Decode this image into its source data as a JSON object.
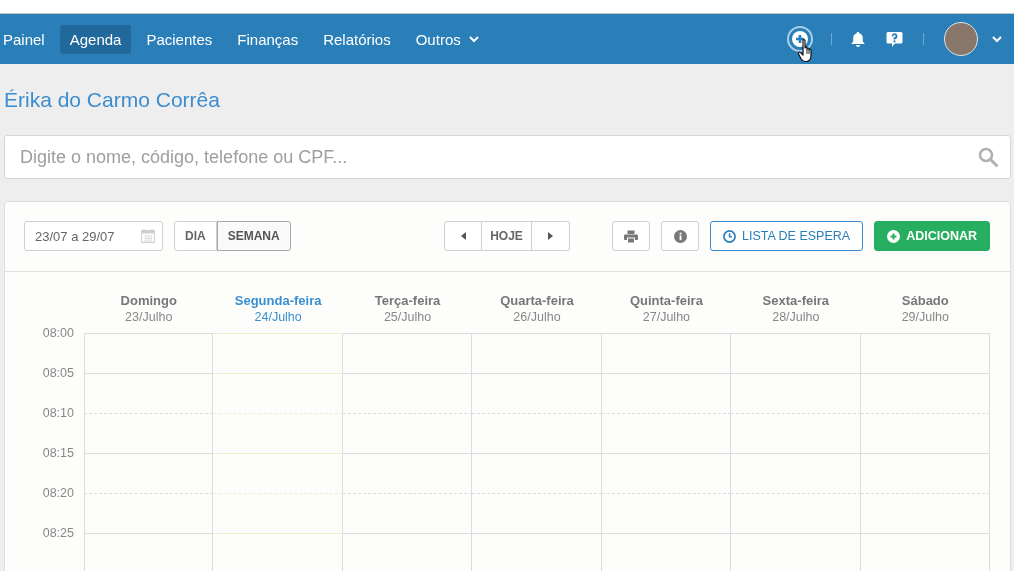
{
  "top_nav": {
    "items": [
      {
        "label": "Painel",
        "selected": false,
        "kind": "link"
      },
      {
        "label": "Agenda",
        "selected": true,
        "kind": "link"
      },
      {
        "label": "Pacientes",
        "selected": false,
        "kind": "link"
      },
      {
        "label": "Finanças",
        "selected": false,
        "kind": "link"
      },
      {
        "label": "Relatórios",
        "selected": false,
        "kind": "link"
      },
      {
        "label": "Outros",
        "selected": false,
        "kind": "dropdown"
      }
    ]
  },
  "patient_name": "Érika do Carmo Corrêa",
  "search": {
    "placeholder": "Digite o nome, código, telefone ou CPF..."
  },
  "toolbar": {
    "date_range": "23/07 a 29/07",
    "view_modes": [
      {
        "label": "DIA",
        "selected": false
      },
      {
        "label": "SEMANA",
        "selected": true
      }
    ],
    "today_button": "HOJE",
    "waitlist_button": "LISTA DE ESPERA",
    "add_button": "ADICIONAR"
  },
  "calendar": {
    "days": [
      {
        "name": "Domingo",
        "date": "23/Julho",
        "selected": false
      },
      {
        "name": "Segunda-feira",
        "date": "24/Julho",
        "selected": true
      },
      {
        "name": "Terça-feira",
        "date": "25/Julho",
        "selected": false
      },
      {
        "name": "Quarta-feira",
        "date": "26/Julho",
        "selected": false
      },
      {
        "name": "Quinta-feira",
        "date": "27/Julho",
        "selected": false
      },
      {
        "name": "Sexta-feira",
        "date": "28/Julho",
        "selected": false
      },
      {
        "name": "Sábado",
        "date": "29/Julho",
        "selected": false
      }
    ],
    "time_slots": [
      {
        "time": "08:00",
        "kind": "solid"
      },
      {
        "time": "08:05",
        "kind": "solid"
      },
      {
        "time": "08:10",
        "kind": "dashed"
      },
      {
        "time": "08:15",
        "kind": "solid"
      },
      {
        "time": "08:20",
        "kind": "dashed"
      },
      {
        "time": "08:25",
        "kind": "solid"
      }
    ]
  }
}
